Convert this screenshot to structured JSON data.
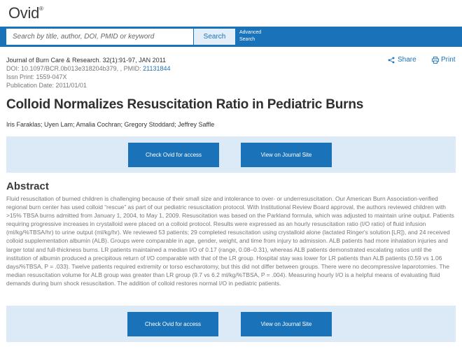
{
  "header": {
    "logo": "Ovid",
    "logo_mark": "®"
  },
  "search": {
    "placeholder": "Search by title, author, DOI, PMID or keyword",
    "button_label": "Search",
    "advanced_label_line1": "Advanced",
    "advanced_label_line2": "Search"
  },
  "article": {
    "journal": "Journal of Burn Care & Research. 32(1):91-97, JAN 2011",
    "doi_prefix": "DOI: 10.1097/BCR.0b013e318204b379,",
    "pmid_prefix": ", PMID:",
    "pmid": "21131844",
    "issn": "Issn Print: 1559-047X",
    "pub_date": "Publication Date: 2011/01/01",
    "title": "Colloid Normalizes Resuscitation Ratio in Pediatric Burns",
    "authors": "Iris Faraklas; Uyen Lam; Amalia Cochran; Gregory Stoddard; Jeffrey Saffle"
  },
  "actions": {
    "share": "Share",
    "print": "Print"
  },
  "access": {
    "check_ovid": "Check Ovid for access",
    "view_journal": "View on Journal Site"
  },
  "abstract": {
    "heading": "Abstract",
    "text": "Fluid resuscitation of burned children is challenging because of their small size and intolerance to over- or underresuscitation. Our American Burn Association-verified regional burn center has used colloid “rescue” as part of our pediatric resuscitation protocol. With Institutional Review Board approval, the authors reviewed children with >15% TBSA burns admitted from January 1, 2004, to May 1, 2009. Resuscitation was based on the Parkland formula, which was adjusted to maintain urine output. Patients requiring progressive increases in crystalloid were placed on a colloid protocol. Results were expressed as an hourly resuscitation ratio (I/O ratio) of fluid infusion (ml/kg/%TBSA/hr) to urine output (ml/kg/hr). We reviewed 53 patients; 29 completed resuscitation using crystalloid alone (lactated Ringer's solution [LR]), and 24 received colloid supplementation albumin (ALB). Groups were comparable in age, gender, weight, and time from injury to admission. ALB patients had more inhalation injuries and larger total and full-thickness burns. LR patients maintained a median I/O of 0.17 (range, 0.08–0.31), whereas ALB patients demonstrated escalating ratios until the institution of albumin produced a precipitous return of I/O comparable with that of the LR group. Hospital stay was lower for LR patients than ALB patients (0.59 vs 1.06 days/%TBSA, P = .033). Twelve patients required extremity or torso escharotomy, but this did not differ between groups. There were no decompressive laparotomies. The median resuscitation volume for ALB group was greater than LR group (9.7 vs 6.2 ml/kg/%TBSA, P = .004). Measuring hourly I/O is a helpful means of evaluating fluid demands during burn shock resuscitation. The addition of colloid restores normal I/O in pediatric patients."
  },
  "colors": {
    "brand_blue": "#1a72b8",
    "access_bg": "#dbeaf6"
  }
}
